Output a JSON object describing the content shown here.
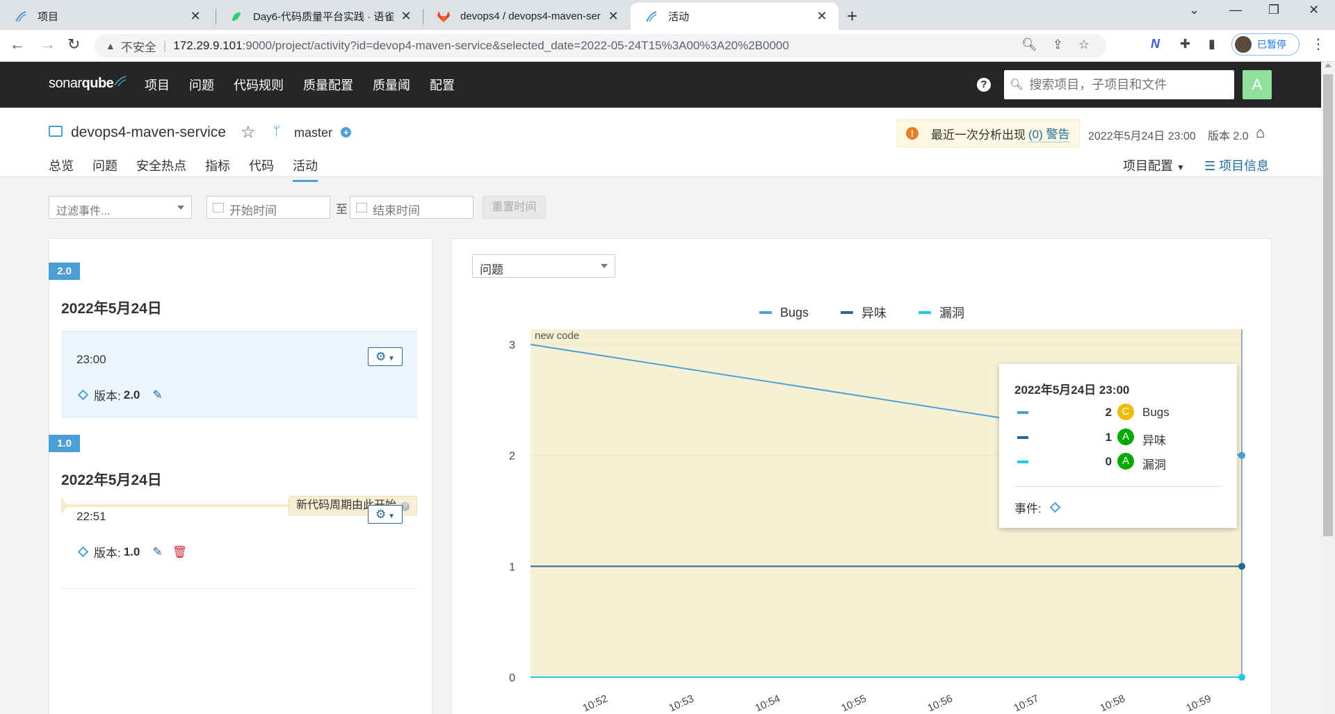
{
  "browser": {
    "tabs": [
      {
        "title": "项目",
        "icon": "sonarqube-icon"
      },
      {
        "title": "Day6-代码质量平台实践 · 语雀",
        "icon": "yuque-icon"
      },
      {
        "title": "devops4 / devops4-maven-ser",
        "icon": "gitlab-icon"
      },
      {
        "title": "活动",
        "icon": "sonarqube-icon"
      }
    ],
    "active_tab": 3,
    "insecure_label": "不安全",
    "url_host": "172.29.9.101",
    "url_path": ":9000/project/activity?id=devop4-maven-service&selected_date=2022-05-24T15%3A00%3A20%2B0000",
    "profile_label": "已暂停"
  },
  "sonar": {
    "logo_text_a": "sonar",
    "logo_text_b": "qube",
    "nav": [
      "项目",
      "问题",
      "代码规则",
      "质量配置",
      "质量阈",
      "配置"
    ],
    "search_placeholder": "搜索项目，子项目和文件",
    "avatar_letter": "A"
  },
  "project": {
    "name": "devops4-maven-service",
    "branch": "master",
    "warning_text": "最近一次分析出现",
    "warning_link": "(0) 警告",
    "analysis_date": "2022年5月24日 23:00",
    "version_label": "版本 2.0",
    "tabs": [
      "总览",
      "问题",
      "安全热点",
      "指标",
      "代码",
      "活动"
    ],
    "active_tab": "活动",
    "config_label": "项目配置",
    "info_label": "项目信息"
  },
  "filters": {
    "event_filter_placeholder": "过滤事件...",
    "start_placeholder": "开始时间",
    "to_label": "至",
    "end_placeholder": "结束时间",
    "reset_label": "重置时间"
  },
  "history": [
    {
      "version_badge": "2.0",
      "day": "2022年5月24日",
      "time": "23:00",
      "version_prefix": "版本:",
      "version_value": "2.0"
    },
    {
      "version_badge": "1.0",
      "day": "2022年5月24日",
      "new_code_label": "新代码周期由此开始",
      "time": "22:51",
      "version_prefix": "版本:",
      "version_value": "1.0"
    }
  ],
  "graph": {
    "metric_select": "问题",
    "new_code_label": "new code",
    "tooltip": {
      "title": "2022年5月24日 23:00",
      "rows": [
        {
          "value": "2",
          "rating": "C",
          "rating_color": "#eabe06",
          "name": "Bugs",
          "color": "#4b9fd5"
        },
        {
          "value": "1",
          "rating": "A",
          "rating_color": "#00aa00",
          "name": "异味",
          "color": "#236a97"
        },
        {
          "value": "0",
          "rating": "A",
          "rating_color": "#00aa00",
          "name": "漏洞",
          "color": "#24c6e0"
        }
      ],
      "events_label": "事件:"
    }
  },
  "chart_data": {
    "type": "line",
    "x": [
      "22:51",
      "23:00"
    ],
    "x_ticks": [
      "10:52",
      "10:53",
      "10:54",
      "10:55",
      "10:56",
      "10:57",
      "10:58",
      "10:59"
    ],
    "y_ticks": [
      "0",
      "1",
      "2",
      "3"
    ],
    "ylim": [
      0,
      3
    ],
    "legend_placement": "top",
    "series": [
      {
        "name": "Bugs",
        "values": [
          3,
          2
        ],
        "color": "#4b9fd5"
      },
      {
        "name": "异味",
        "values": [
          1,
          1
        ],
        "color": "#236a97"
      },
      {
        "name": "漏洞",
        "values": [
          0,
          0
        ],
        "color": "#24c6e0"
      }
    ]
  }
}
